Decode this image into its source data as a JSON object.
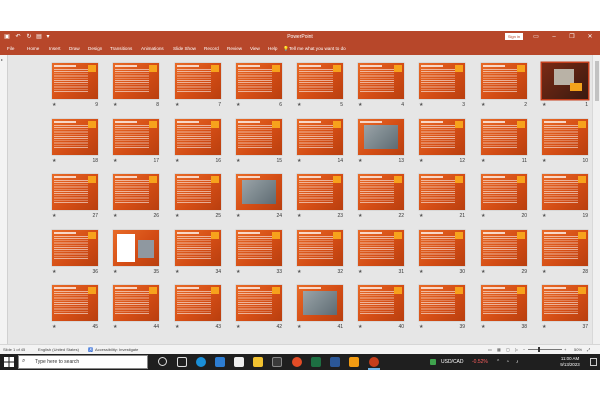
{
  "titlebar": {
    "title": "PowerPoint",
    "signin_label": "Sign in"
  },
  "menu": {
    "items": [
      "File",
      "Home",
      "Insert",
      "Draw",
      "Design",
      "Transitions",
      "Animations",
      "Slide Show",
      "Record",
      "Review",
      "View",
      "Help"
    ],
    "tellme": "Tell me what you want to do"
  },
  "slides": {
    "rows": [
      [
        "9",
        "8",
        "7",
        "6",
        "5",
        "4",
        "3",
        "2",
        "1"
      ],
      [
        "18",
        "17",
        "16",
        "15",
        "14",
        "13",
        "12",
        "11",
        "10"
      ],
      [
        "27",
        "26",
        "25",
        "24",
        "23",
        "22",
        "21",
        "20",
        "19"
      ],
      [
        "36",
        "35",
        "34",
        "33",
        "32",
        "31",
        "30",
        "29",
        "28"
      ],
      [
        "45",
        "44",
        "43",
        "42",
        "41",
        "40",
        "39",
        "38",
        "37"
      ]
    ],
    "selected": "1"
  },
  "status": {
    "slide_count": "Slide 1 of 45",
    "language": "English (United States)",
    "accessibility": "Accessibility: Investigate",
    "zoom": "50%"
  },
  "taskbar": {
    "search_placeholder": "Type here to search",
    "currency_label": "USD/CAD",
    "currency_change": "-0.52%",
    "time": "11:00 AM",
    "date": "9/13/2023",
    "accent_color": "#b7472a"
  }
}
